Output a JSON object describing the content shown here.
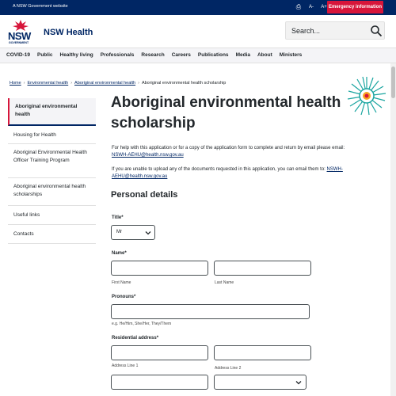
{
  "masthead": {
    "gov_label": "A NSW Government website",
    "emergency_label": "Emergency information",
    "icons": [
      "printer-icon",
      "text-decrease-icon",
      "text-increase-icon"
    ],
    "icon_glyphs": {
      "print": "⎙",
      "decrease": "A-",
      "increase": "A+"
    }
  },
  "header": {
    "logo_text": "NSW",
    "logo_sub": "GOVERNMENT",
    "site_title": "NSW Health",
    "search_placeholder": "Search..."
  },
  "nav": {
    "items": [
      "COVID-19",
      "Public",
      "Healthy living",
      "Professionals",
      "Research",
      "Careers",
      "Publications",
      "Media",
      "About",
      "Ministers"
    ]
  },
  "breadcrumb": {
    "items": [
      "Home",
      "Environmental health",
      "Aboriginal environmental health"
    ],
    "current": "Aboriginal environmental health scholarship"
  },
  "sidebar": {
    "items": [
      {
        "label": "Aboriginal environmental health",
        "active": true
      },
      {
        "label": "Housing for Health",
        "active": false
      },
      {
        "label": "Aboriginal Environmental Health Officer Training Program",
        "active": false
      },
      {
        "label": "Aboriginal environmental health scholarships",
        "active": false
      },
      {
        "label": "Useful links",
        "active": false
      },
      {
        "label": "Contacts",
        "active": false
      }
    ]
  },
  "main": {
    "title": "Aboriginal environmental health scholarship",
    "help_text": "For help with this application or for a copy of the application form to complete and return by email please email:",
    "help_email": "NSWH-AEHU@health.nsw.gov.au",
    "upload_text": "If you are unable to upload any of the documents requested in this application, you can email them to:",
    "upload_email": "NSWH-AEHU@health.nsw.gov.au",
    "section_title": "Personal details"
  },
  "form": {
    "title_label": "Title*",
    "title_value": "Mr",
    "name_label": "Name*",
    "first_name_hint": "First Name",
    "last_name_hint": "Last Name",
    "pronouns_label": "Pronouns*",
    "pronouns_hint": "e.g. He/Him, She/Her, They/Them",
    "address_label": "Residential address*",
    "address_line1_hint": "Address Line 1",
    "address_line2_hint": "Address Line 2"
  },
  "colors": {
    "brand_navy": "#002664",
    "brand_red": "#d7153a"
  }
}
